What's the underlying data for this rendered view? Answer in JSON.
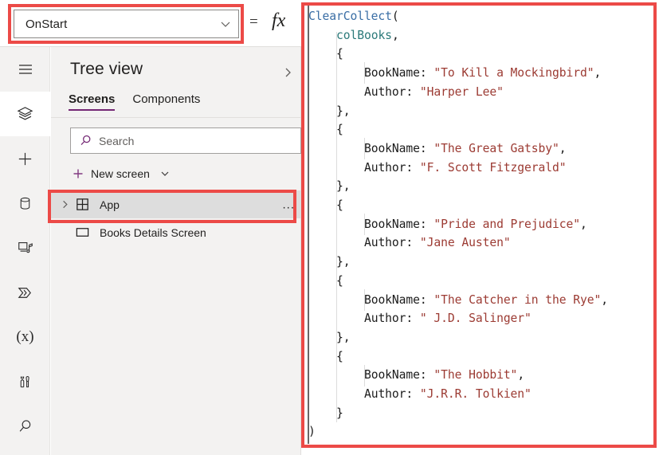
{
  "topbar": {
    "property_dropdown": {
      "value": "OnStart",
      "chevron_icon": "chevron-down-icon"
    },
    "equals_sign": "=",
    "fx_label": "fx"
  },
  "rail": {
    "items": [
      {
        "icon": "hamburger-menu-icon",
        "name": "menu",
        "active": false
      },
      {
        "icon": "layers-icon",
        "name": "tree-view",
        "active": true
      },
      {
        "icon": "plus-icon",
        "name": "insert",
        "active": false
      },
      {
        "icon": "database-icon",
        "name": "data",
        "active": false
      },
      {
        "icon": "media-icon",
        "name": "media",
        "active": false
      },
      {
        "icon": "power-automate-icon",
        "name": "power-automate",
        "active": false
      },
      {
        "icon": "variables-icon",
        "name": "variables",
        "glyph": "(x)",
        "active": false
      },
      {
        "icon": "tools-icon",
        "name": "advanced-tools",
        "active": false
      },
      {
        "icon": "search-icon",
        "name": "search",
        "active": false
      }
    ]
  },
  "tree": {
    "title": "Tree view",
    "collapse_icon": "chevron-right-icon",
    "tabs": [
      {
        "label": "Screens",
        "selected": true
      },
      {
        "label": "Components",
        "selected": false
      }
    ],
    "search": {
      "placeholder": "Search",
      "icon": "search-icon"
    },
    "new_screen": {
      "label": "New screen",
      "plus_icon": "plus-icon",
      "chevron_icon": "chevron-down-icon"
    },
    "items": [
      {
        "label": "App",
        "icon": "app-grid-icon",
        "expander": "chevron-right-icon",
        "selected": true,
        "overflow": "..."
      },
      {
        "label": "Books Details Screen",
        "icon": "screen-rectangle-icon",
        "expander": null,
        "selected": false,
        "overflow": ""
      }
    ]
  },
  "formula": {
    "lines": [
      {
        "indent": 0,
        "tokens": [
          {
            "t": "fn",
            "s": "ClearCollect"
          },
          {
            "t": "punct",
            "s": "("
          }
        ]
      },
      {
        "indent": 1,
        "tokens": [
          {
            "t": "coll",
            "s": "colBooks"
          },
          {
            "t": "punct",
            "s": ","
          }
        ]
      },
      {
        "indent": 1,
        "tokens": [
          {
            "t": "punct",
            "s": "{"
          }
        ]
      },
      {
        "indent": 2,
        "tokens": [
          {
            "t": "fld",
            "s": "BookName: "
          },
          {
            "t": "str",
            "s": "\"To Kill a Mockingbird\""
          },
          {
            "t": "punct",
            "s": ","
          }
        ]
      },
      {
        "indent": 2,
        "tokens": [
          {
            "t": "fld",
            "s": "Author: "
          },
          {
            "t": "str",
            "s": "\"Harper Lee\""
          }
        ]
      },
      {
        "indent": 1,
        "tokens": [
          {
            "t": "punct",
            "s": "},"
          }
        ]
      },
      {
        "indent": 1,
        "tokens": [
          {
            "t": "punct",
            "s": "{"
          }
        ]
      },
      {
        "indent": 2,
        "tokens": [
          {
            "t": "fld",
            "s": "BookName: "
          },
          {
            "t": "str",
            "s": "\"The Great Gatsby\""
          },
          {
            "t": "punct",
            "s": ","
          }
        ]
      },
      {
        "indent": 2,
        "tokens": [
          {
            "t": "fld",
            "s": "Author: "
          },
          {
            "t": "str",
            "s": "\"F. Scott Fitzgerald\""
          }
        ]
      },
      {
        "indent": 1,
        "tokens": [
          {
            "t": "punct",
            "s": "},"
          }
        ]
      },
      {
        "indent": 1,
        "tokens": [
          {
            "t": "punct",
            "s": "{"
          }
        ]
      },
      {
        "indent": 2,
        "tokens": [
          {
            "t": "fld",
            "s": "BookName: "
          },
          {
            "t": "str",
            "s": "\"Pride and Prejudice\""
          },
          {
            "t": "punct",
            "s": ","
          }
        ]
      },
      {
        "indent": 2,
        "tokens": [
          {
            "t": "fld",
            "s": "Author: "
          },
          {
            "t": "str",
            "s": "\"Jane Austen\""
          }
        ]
      },
      {
        "indent": 1,
        "tokens": [
          {
            "t": "punct",
            "s": "},"
          }
        ]
      },
      {
        "indent": 1,
        "tokens": [
          {
            "t": "punct",
            "s": "{"
          }
        ]
      },
      {
        "indent": 2,
        "tokens": [
          {
            "t": "fld",
            "s": "BookName: "
          },
          {
            "t": "str",
            "s": "\"The Catcher in the Rye\""
          },
          {
            "t": "punct",
            "s": ","
          }
        ]
      },
      {
        "indent": 2,
        "tokens": [
          {
            "t": "fld",
            "s": "Author: "
          },
          {
            "t": "str",
            "s": "\" J.D. Salinger\""
          }
        ]
      },
      {
        "indent": 1,
        "tokens": [
          {
            "t": "punct",
            "s": "},"
          }
        ]
      },
      {
        "indent": 1,
        "tokens": [
          {
            "t": "punct",
            "s": "{"
          }
        ]
      },
      {
        "indent": 2,
        "tokens": [
          {
            "t": "fld",
            "s": "BookName: "
          },
          {
            "t": "str",
            "s": "\"The Hobbit\""
          },
          {
            "t": "punct",
            "s": ","
          }
        ]
      },
      {
        "indent": 2,
        "tokens": [
          {
            "t": "fld",
            "s": "Author: "
          },
          {
            "t": "str",
            "s": "\"J.R.R. Tolkien\""
          }
        ]
      },
      {
        "indent": 1,
        "tokens": [
          {
            "t": "punct",
            "s": "}"
          }
        ]
      },
      {
        "indent": 0,
        "tokens": [
          {
            "t": "punct",
            "s": ")"
          }
        ]
      }
    ]
  },
  "annotations": {
    "color": "#ec4a47",
    "boxes": [
      "property-dropdown",
      "app-tree-item",
      "formula-bar"
    ]
  },
  "colors": {
    "accent_purple": "#742774",
    "panel_bg": "#f3f2f1",
    "selected_row": "#dddddd",
    "syntax_function": "#3a6ea5",
    "syntax_collection": "#2c7a7a",
    "syntax_string": "#9c3b33",
    "annotation_red": "#ec4a47"
  }
}
